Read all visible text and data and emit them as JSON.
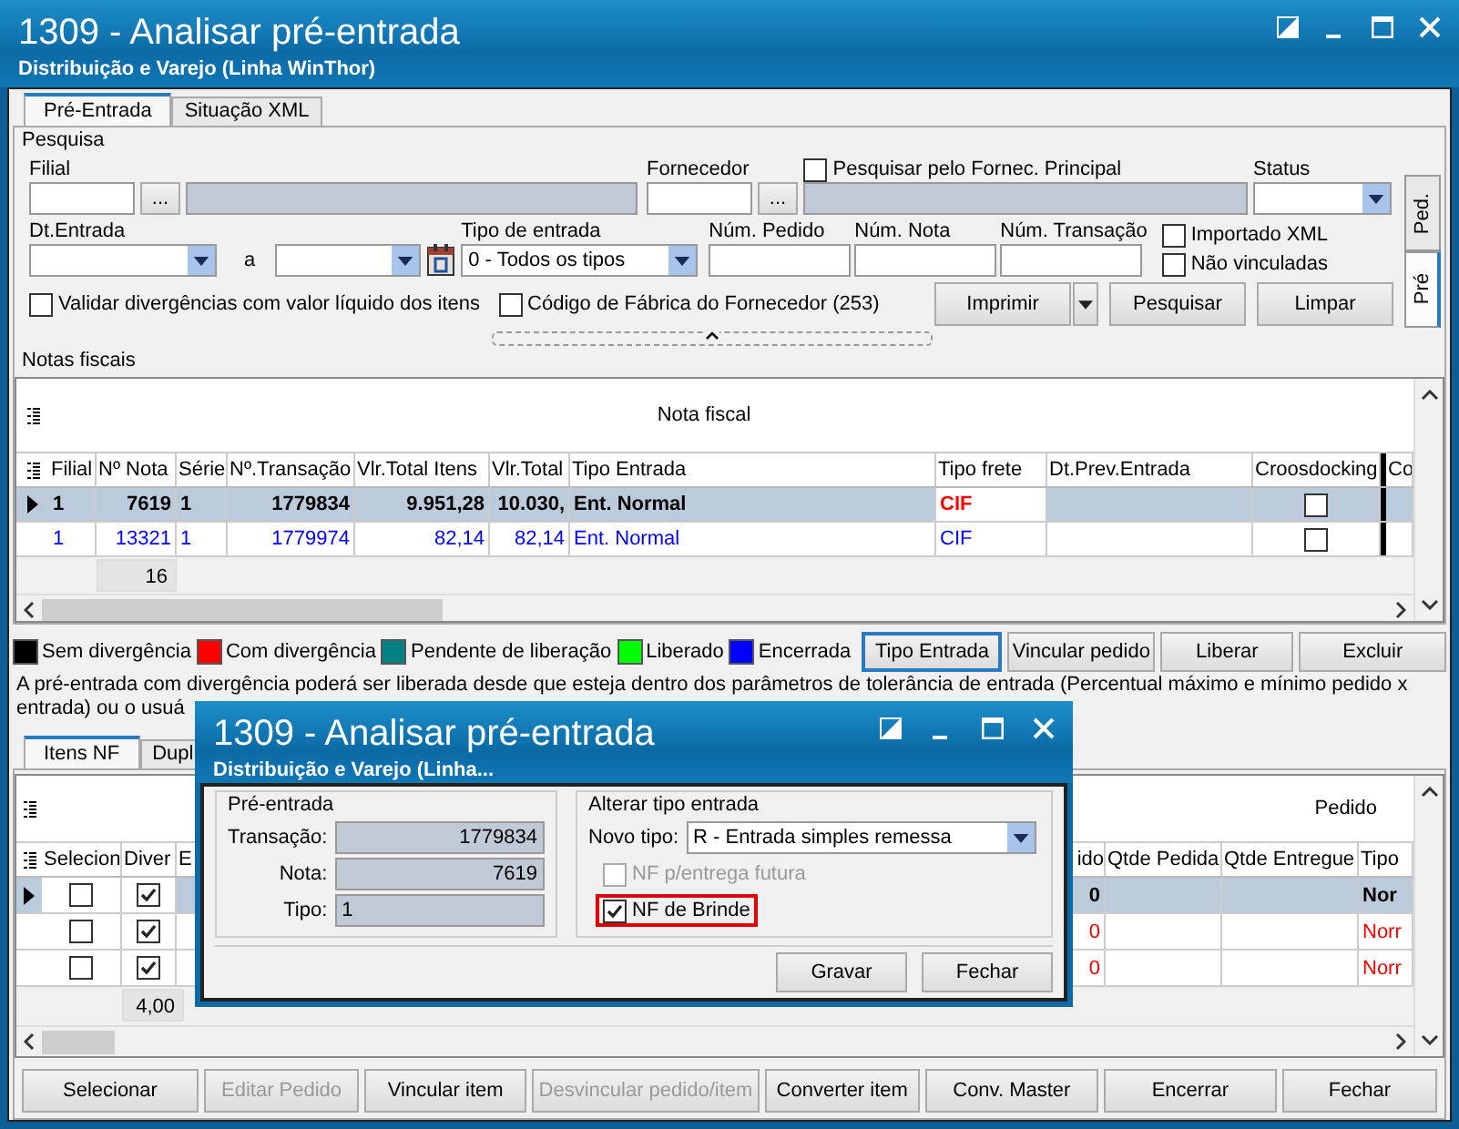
{
  "window": {
    "title": "1309 - Analisar pré-entrada",
    "subtitle": "Distribuição e Varejo (Linha WinThor)"
  },
  "tabs": [
    {
      "label": "Pré-Entrada",
      "selected": true
    },
    {
      "label": "Situação XML",
      "selected": false
    }
  ],
  "side_tabs": [
    {
      "label": "Ped.",
      "selected": false
    },
    {
      "label": "Pré",
      "selected": true
    }
  ],
  "search": {
    "group_title": "Pesquisa",
    "filial": {
      "label": "Filial",
      "button": "..."
    },
    "fornecedor": {
      "label": "Fornecedor",
      "button": "..."
    },
    "principal": {
      "label": "Pesquisar pelo Fornec. Principal",
      "checked": false
    },
    "status": {
      "label": "Status"
    },
    "dt_entrada": {
      "label": "Dt.Entrada",
      "separator": "a"
    },
    "tipo_entrada": {
      "label": "Tipo de entrada",
      "value": "0 - Todos os tipos"
    },
    "text_fields": [
      {
        "label": "Núm. Pedido"
      },
      {
        "label": "Núm. Nota"
      },
      {
        "label": "Núm. Transação"
      }
    ],
    "flags": [
      {
        "label": "Importado XML",
        "checked": false
      },
      {
        "label": "Não vinculadas",
        "checked": false
      }
    ],
    "options": [
      {
        "label": "Validar divergências com valor líquido dos itens",
        "checked": false
      },
      {
        "label": "Código de Fábrica do Fornecedor (253)",
        "checked": false
      }
    ],
    "buttons": [
      "Imprimir",
      "Pesquisar",
      "Limpar"
    ]
  },
  "notas": {
    "group_title": "Notas fiscais",
    "group_header": "Nota fiscal",
    "columns": [
      "Filial",
      "Nº Nota",
      "Série",
      "Nº.Transação",
      "Vlr.Total Itens",
      "Vlr.Total",
      "Tipo Entrada",
      "Tipo frete",
      "Dt.Prev.Entrada",
      "Croosdocking",
      "Co"
    ],
    "rows": [
      {
        "selected": true,
        "color": "#000000",
        "croosdocking": false,
        "cells": [
          "1",
          "7619",
          "1",
          "1779834",
          "9.951,28",
          "10.030,",
          "Ent. Normal"
        ],
        "freight": {
          "text": "CIF",
          "color": "#ff0000"
        }
      },
      {
        "selected": false,
        "color": "#0000ff",
        "croosdocking": false,
        "cells": [
          "1",
          "13321",
          "1",
          "1779974",
          "82,14",
          "82,14",
          "Ent. Normal"
        ],
        "freight": {
          "text": "CIF",
          "color": "#0000ff"
        }
      }
    ],
    "footer_count": "16"
  },
  "legend": [
    {
      "label": "Sem divergência",
      "color": "#000000"
    },
    {
      "label": "Com divergência",
      "color": "#ff0000"
    },
    {
      "label": "Pendente de liberação",
      "color": "#008080"
    },
    {
      "label": "Liberado",
      "color": "#00ff00"
    },
    {
      "label": "Encerrada",
      "color": "#0000ff"
    }
  ],
  "actions": [
    {
      "label": "Tipo Entrada",
      "focused": true
    },
    {
      "label": "Vincular pedido",
      "focused": false
    },
    {
      "label": "Liberar",
      "focused": false
    },
    {
      "label": "Excluir",
      "focused": false
    }
  ],
  "notice_lines": [
    "A pré-entrada com divergência poderá ser liberada desde que esteja dentro dos parâmetros de tolerância de entrada (Percentual máximo e mínimo pedido x",
    "entrada) ou o usuá"
  ],
  "lower_tabs": [
    {
      "label": "Itens NF",
      "selected": true
    },
    {
      "label": "Dupl",
      "selected": false
    }
  ],
  "itens": {
    "group_header": "Pedido",
    "columns": [
      "Selecion",
      "Diver",
      "E",
      "ido",
      "Qtde Pedida",
      "Qtde Entregue",
      "Tipo"
    ],
    "rows": [
      {
        "selected": true,
        "checked": false,
        "divergent": true,
        "color": "#000000",
        "pedido": "0",
        "tipo": "Nor"
      },
      {
        "selected": false,
        "checked": false,
        "divergent": true,
        "color": "#ff0000",
        "pedido": "0",
        "tipo": "Norr"
      },
      {
        "selected": false,
        "checked": false,
        "divergent": true,
        "color": "#ff0000",
        "pedido": "0",
        "tipo": "Norr"
      }
    ],
    "footer_total": "4,00"
  },
  "bottom_buttons": [
    {
      "label": "Selecionar",
      "disabled": false
    },
    {
      "label": "Editar Pedido",
      "disabled": true
    },
    {
      "label": "Vincular item",
      "disabled": false
    },
    {
      "label": "Desvincular pedido/item",
      "disabled": true
    },
    {
      "label": "Converter item",
      "disabled": false
    },
    {
      "label": "Conv. Master",
      "disabled": false
    },
    {
      "label": "Encerrar",
      "disabled": false
    },
    {
      "label": "Fechar",
      "disabled": false
    }
  ],
  "dialog": {
    "title": "1309 - Analisar pré-entrada",
    "subtitle": "Distribuição e Varejo (Linha...",
    "pre_entrada": {
      "title": "Pré-entrada",
      "fields": [
        {
          "label": "Transação:",
          "value": "1779834"
        },
        {
          "label": "Nota:",
          "value": "7619"
        },
        {
          "label": "Tipo:",
          "value": "1"
        }
      ]
    },
    "alterar": {
      "title": "Alterar tipo entrada",
      "novo_tipo": {
        "label": "Novo tipo:",
        "value": "R - Entrada simples remessa"
      },
      "options": [
        {
          "label": "NF p/entrega futura",
          "checked": false,
          "disabled": true,
          "highlighted": false
        },
        {
          "label": "NF de Brinde",
          "checked": true,
          "disabled": false,
          "highlighted": true
        }
      ]
    },
    "buttons": [
      "Gravar",
      "Fechar"
    ]
  }
}
